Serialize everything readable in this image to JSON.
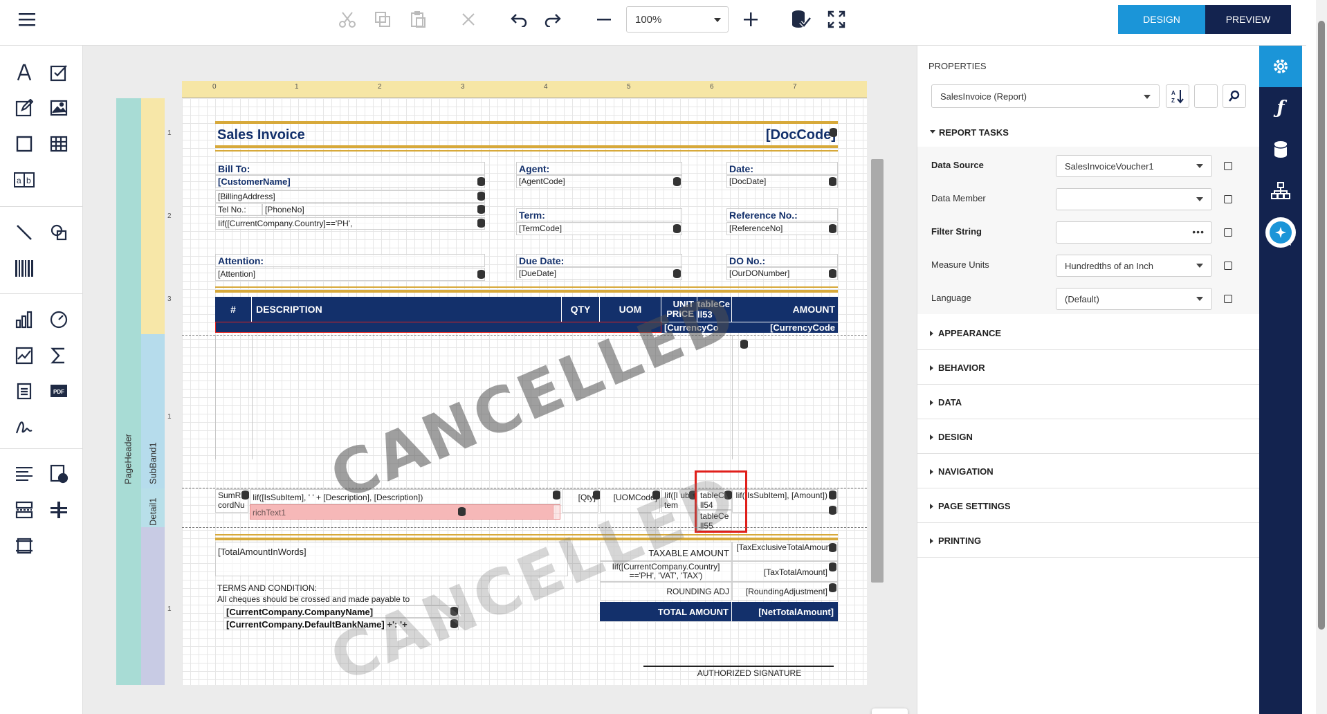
{
  "toolbar": {
    "zoom": "100%",
    "design_label": "DESIGN",
    "preview_label": "PREVIEW"
  },
  "report": {
    "title": "Sales Invoice",
    "doc_code": "[DocCode]",
    "bill_to_label": "Bill To:",
    "customer_name": "[CustomerName]",
    "billing_address": "[BillingAddress]",
    "tel_label": "Tel No.:",
    "phone": "[PhoneNo]",
    "country_expr": "Iif([CurrentCompany.Country]=='PH',",
    "attention_label": "Attention:",
    "attention": "[Attention]",
    "agent_label": "Agent:",
    "agent": "[AgentCode]",
    "term_label": "Term:",
    "term": "[TermCode]",
    "due_label": "Due Date:",
    "due": "[DueDate]",
    "date_label": "Date:",
    "date": "[DocDate]",
    "ref_label": "Reference No.:",
    "ref": "[ReferenceNo]",
    "do_label": "DO No.:",
    "do_no": "[OurDONumber]",
    "table_headers": {
      "num": "#",
      "description": "DESCRIPTION",
      "qty": "QTY",
      "uom": "UOM",
      "unit_price": "UNIT PRICE",
      "cell53": "tableCell53",
      "amount": "AMOUNT"
    },
    "currency_1": "[CurrencyCo",
    "currency_2": "[CurrencyCode",
    "detail": {
      "sum": "SumR cordNu",
      "desc_expr": "Iif([IsSubItem], '   ' + [Description], [Description])",
      "qty": "[Qty]",
      "uom": "[UOMCode]",
      "sub_item": "Iif([I ubItem",
      "cell54": "tableCell54",
      "cell55": "tableCell55",
      "amount_expr": "Iif([IsSubItem], [Amount])",
      "rich_text": "richText1"
    },
    "total_in_words": "[TotalAmountInWords]",
    "taxable_label": "TAXABLE AMOUNT",
    "tax_excl": "[TaxExclusiveTotalAmount]",
    "vat_expr": "Iif([CurrentCompany.Country] =='PH', 'VAT', 'TAX')",
    "tax_total": "[TaxTotalAmount]",
    "rounding_label": "ROUNDING ADJ",
    "rounding": "[RoundingAdjustment]",
    "total_label": "TOTAL AMOUNT",
    "net_total": "[NetTotalAmount]",
    "terms_title": "TERMS AND CONDITION:",
    "terms_text": "All cheques should be crossed and made payable to",
    "company_name": "[CurrentCompany.CompanyName]",
    "bank_expr": "[CurrentCompany.DefaultBankName] +': '+",
    "authorized": "AUTHORIZED SIGNATURE",
    "watermark": "CANCELLED"
  },
  "bands": {
    "page_header": "PageHeader",
    "subband": "SubBand1",
    "detail": "Detail1"
  },
  "ruler_top": [
    "0",
    "1",
    "2",
    "3",
    "4",
    "5",
    "6",
    "7"
  ],
  "ruler_left": [
    "1",
    "2",
    "3",
    "1",
    "1"
  ],
  "properties": {
    "title": "PROPERTIES",
    "object": "SalesInvoice (Report)",
    "report_tasks": "REPORT TASKS",
    "rows": [
      {
        "name": "Data Source",
        "value": "SalesInvoiceVoucher1",
        "bold": true
      },
      {
        "name": "Data Member",
        "value": "",
        "bold": false
      },
      {
        "name": "Filter String",
        "value": "",
        "bold": true
      },
      {
        "name": "Measure Units",
        "value": "Hundredths of an Inch",
        "bold": false
      },
      {
        "name": "Language",
        "value": "(Default)",
        "bold": false
      }
    ],
    "categories": [
      "APPEARANCE",
      "BEHAVIOR",
      "DATA",
      "DESIGN",
      "NAVIGATION",
      "PAGE SETTINGS",
      "PRINTING"
    ]
  },
  "colors": {
    "navy": "#13306b",
    "accent": "#1b95d8",
    "gold": "#d7a93a",
    "highlight_red": "#e0201b"
  }
}
